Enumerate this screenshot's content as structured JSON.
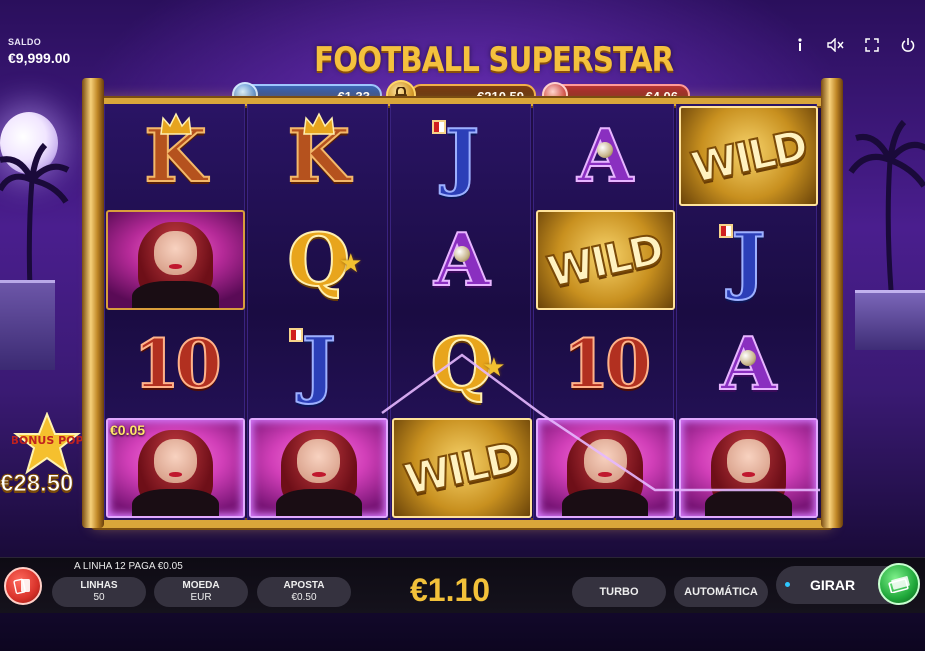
{
  "hud": {
    "saldo_label": "SALDO",
    "saldo_value": "€9,999.00",
    "icons": [
      "info-icon",
      "mute-icon",
      "fullscreen-icon",
      "power-icon"
    ]
  },
  "title": "FOOTBALL SUPERSTAR",
  "jackpots": {
    "left": "€1.33",
    "middle": "€210.59",
    "right": "€4.06"
  },
  "reels": [
    [
      "K",
      "girl",
      "10",
      "girl"
    ],
    [
      "K",
      "Q",
      "J",
      "girl"
    ],
    [
      "J",
      "A",
      "Q",
      "WILD"
    ],
    [
      "A",
      "WILD",
      "10",
      "girl"
    ],
    [
      "WILD",
      "J",
      "A",
      "girl"
    ]
  ],
  "win_cell_amount": "€0.05",
  "wild_label": "WILD",
  "bonus": {
    "label": "BONUS POP",
    "amount": "€28.50"
  },
  "bottom": {
    "line_message": "A LINHA 12 PAGA €0.05",
    "linhas_label": "LINHAS",
    "linhas_value": "50",
    "moeda_label": "MOEDA",
    "moeda_value": "EUR",
    "aposta_label": "APOSTA",
    "aposta_value": "€0.50",
    "total_bet": "€1.10",
    "turbo_label": "TURBO",
    "auto_label": "AUTOMÁTICA",
    "spin_label": "GIRAR"
  },
  "colors": {
    "gold": "#f2c13a",
    "frame": "#d9a63a",
    "payline": "#d9a6ff"
  }
}
